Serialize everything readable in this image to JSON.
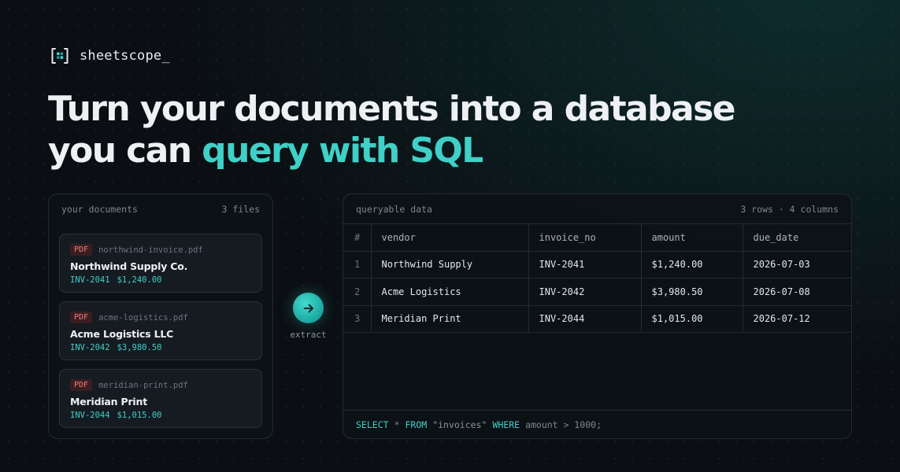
{
  "brand": {
    "name": "sheetscope_",
    "icon": "bracket-grid-logo-icon"
  },
  "headline": {
    "line1": "Turn your documents into a database",
    "line2_plain": "you can ",
    "line2_accent": "query with SQL"
  },
  "documents": {
    "title": "your documents",
    "count": "3 files",
    "items": [
      {
        "badge": "PDF",
        "filename": "northwind-invoice.pdf",
        "company": "Northwind Supply Co.",
        "invoice": "INV-2041",
        "amount": "$1,240.00"
      },
      {
        "badge": "PDF",
        "filename": "acme-logistics.pdf",
        "company": "Acme Logistics LLC",
        "invoice": "INV-2042",
        "amount": "$3,980.50"
      },
      {
        "badge": "PDF",
        "filename": "meridian-print.pdf",
        "company": "Meridian Print",
        "invoice": "INV-2044",
        "amount": "$1,015.00"
      }
    ]
  },
  "extract": {
    "label": "extract",
    "icon": "arrow-right-icon"
  },
  "data_panel": {
    "title": "queryable data",
    "summary": "3 rows · 4 columns",
    "columns": [
      "#",
      "vendor",
      "invoice_no",
      "amount",
      "due_date"
    ],
    "rows": [
      [
        "1",
        "Northwind Supply",
        "INV-2041",
        "$1,240.00",
        "2026-07-03"
      ],
      [
        "2",
        "Acme Logistics",
        "INV-2042",
        "$3,980.50",
        "2026-07-08"
      ],
      [
        "3",
        "Meridian Print",
        "INV-2044",
        "$1,015.00",
        "2026-07-12"
      ]
    ]
  },
  "query": {
    "select": "SELECT",
    "star": "*",
    "from": "FROM",
    "table": "\"invoices\"",
    "where": "WHERE",
    "condition": "amount > 1000;"
  },
  "colors": {
    "accent": "#3fd0c7",
    "background": "#0b0f13",
    "pdf_badge": "#f27b7b"
  }
}
